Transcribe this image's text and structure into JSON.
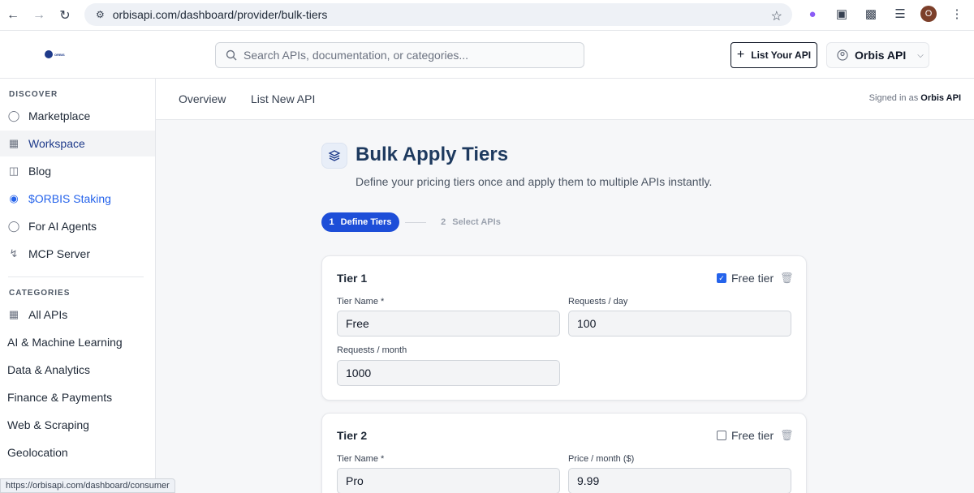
{
  "browser": {
    "url": "orbisapi.com/dashboard/provider/bulk-tiers",
    "profile_initial": "O",
    "status_url": "https://orbisapi.com/dashboard/consumer"
  },
  "header": {
    "logo_text": "ORBIS",
    "search_placeholder": "Search APIs, documentation, or categories...",
    "list_api_label": "List Your API",
    "account_name": "Orbis API"
  },
  "sidebar": {
    "discover_title": "DISCOVER",
    "discover_items": [
      {
        "label": "Marketplace",
        "icon": "globe-icon"
      },
      {
        "label": "Workspace",
        "icon": "grid-icon"
      },
      {
        "label": "Blog",
        "icon": "book-icon"
      },
      {
        "label": "$ORBIS Staking",
        "icon": "coins-icon"
      },
      {
        "label": "For AI Agents",
        "icon": "globe-icon"
      },
      {
        "label": "MCP Server",
        "icon": "bolt-icon"
      }
    ],
    "categories_title": "CATEGORIES",
    "category_items": [
      {
        "label": "All APIs",
        "icon": "grid-icon"
      },
      {
        "label": "AI & Machine Learning"
      },
      {
        "label": "Data & Analytics"
      },
      {
        "label": "Finance & Payments"
      },
      {
        "label": "Web & Scraping"
      },
      {
        "label": "Geolocation"
      }
    ]
  },
  "subnav": {
    "tabs": [
      "Overview",
      "List New API"
    ],
    "signed_in_prefix": "Signed in as",
    "signed_in_name": "Orbis API"
  },
  "main": {
    "title": "Bulk Apply Tiers",
    "subtitle": "Define your pricing tiers once and apply them to multiple APIs instantly.",
    "steps": [
      {
        "num": "1",
        "label": "Define Tiers"
      },
      {
        "num": "2",
        "label": "Select APIs"
      }
    ],
    "free_tier_label": "Free tier",
    "tiers": [
      {
        "title": "Tier 1",
        "free": true,
        "fields": [
          {
            "label": "Tier Name *",
            "value": "Free"
          },
          {
            "label": "Requests / day",
            "value": "100"
          },
          {
            "label": "Requests / month",
            "value": "1000"
          }
        ]
      },
      {
        "title": "Tier 2",
        "free": false,
        "fields": [
          {
            "label": "Tier Name *",
            "value": "Pro"
          },
          {
            "label": "Price / month ($)",
            "value": "9.99"
          }
        ]
      }
    ]
  }
}
